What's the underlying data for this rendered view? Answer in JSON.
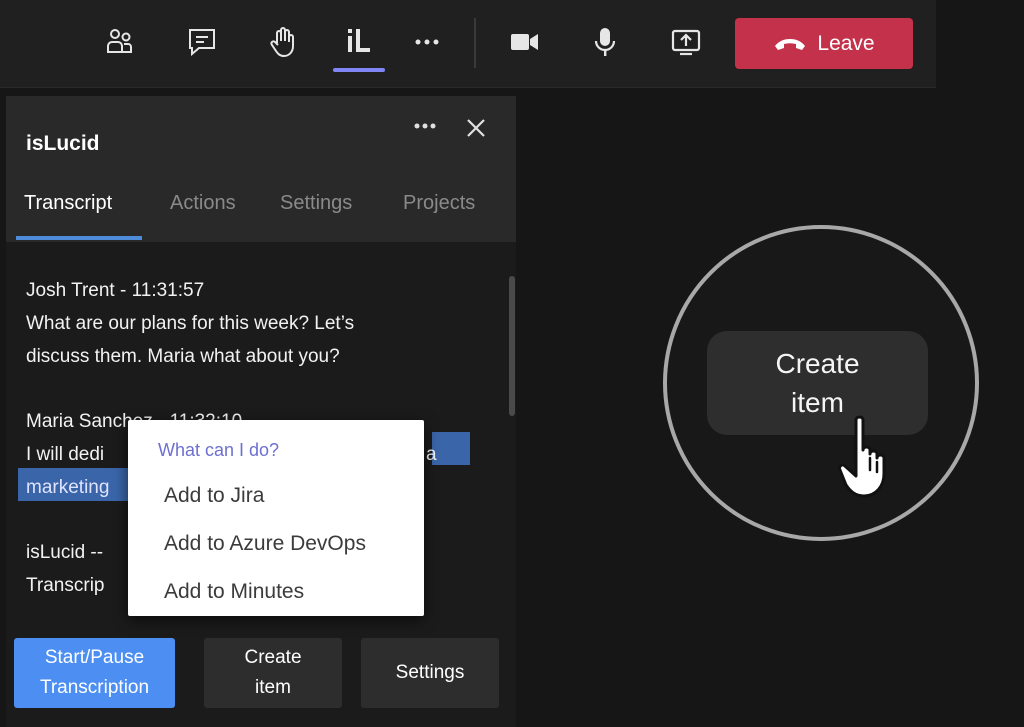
{
  "toolbar": {
    "icons": [
      "people-icon",
      "chat-icon",
      "raise-hand-icon",
      "islucid-app-icon",
      "more-icon",
      "camera-icon",
      "mic-icon",
      "share-screen-icon"
    ],
    "leave_label": "Leave",
    "leave_color": "#c4314b"
  },
  "panel": {
    "title": "isLucid",
    "tabs": [
      {
        "label": "Transcript",
        "active": true
      },
      {
        "label": "Actions",
        "active": false
      },
      {
        "label": "Settings",
        "active": false
      },
      {
        "label": "Projects",
        "active": false
      }
    ]
  },
  "transcript": {
    "entry1": {
      "speaker": "Josh Trent - 11:31:57",
      "line1": "What are our plans for this week? Let’s",
      "line2": "discuss them. Maria what about you?"
    },
    "entry2": {
      "speaker": "Maria Sanchez - 11:32:10",
      "line1": "I will dedi",
      "line1_tail": "a",
      "line2": "marketing"
    },
    "entry3": {
      "speaker": "isLucid --",
      "line1": "Transcrip"
    }
  },
  "menu": {
    "heading": "What can I do?",
    "items": [
      "Add to Jira",
      "Add to Azure DevOps",
      "Add to Minutes"
    ]
  },
  "buttons": {
    "start_pause_l1": "Start/Pause",
    "start_pause_l2": "Transcription",
    "create_l1": "Create",
    "create_l2": "item",
    "settings": "Settings"
  },
  "callout": {
    "create_l1": "Create",
    "create_l2": "item"
  },
  "colors": {
    "accent_blue": "#4c8ef2",
    "highlight": "#3a65a8",
    "menu_heading": "#6d6fd1"
  }
}
